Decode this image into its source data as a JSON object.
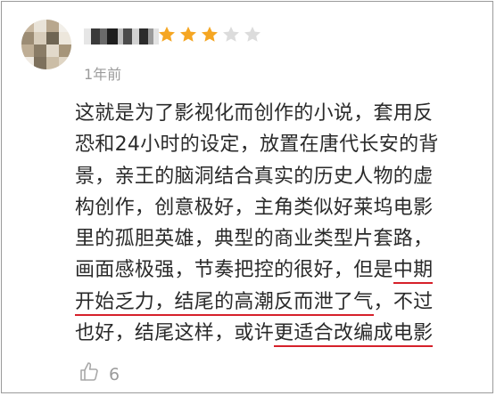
{
  "review": {
    "rating": 3,
    "max_rating": 5,
    "star_color": "#f5a623",
    "star_empty_color": "#dcdcdc",
    "time": "1年前",
    "lines": [
      [
        {
          "t": "这就是为了影视化而创作的小说，套用反"
        }
      ],
      [
        {
          "t": "恐和24小时的设定，放置在唐代长安的背"
        }
      ],
      [
        {
          "t": "景，亲王的脑洞结合真实的历史人物的虚"
        }
      ],
      [
        {
          "t": "构创作，创意极好，主角类似好莱坞电影"
        }
      ],
      [
        {
          "t": "里的孤胆英雄，典型的商业类型片套路，"
        }
      ],
      [
        {
          "t": "画面感极强，节奏把控的很好，但是"
        },
        {
          "t": "中期",
          "u": true
        }
      ],
      [
        {
          "t": "开始乏力，结尾的高潮反而泄了气",
          "u": true
        },
        {
          "t": "，不过"
        }
      ],
      [
        {
          "t": "也好，结尾这样，或许"
        },
        {
          "t": "更适合改编成电影",
          "u": true
        }
      ]
    ],
    "underline_color": "#d6202a",
    "likes": "6"
  }
}
